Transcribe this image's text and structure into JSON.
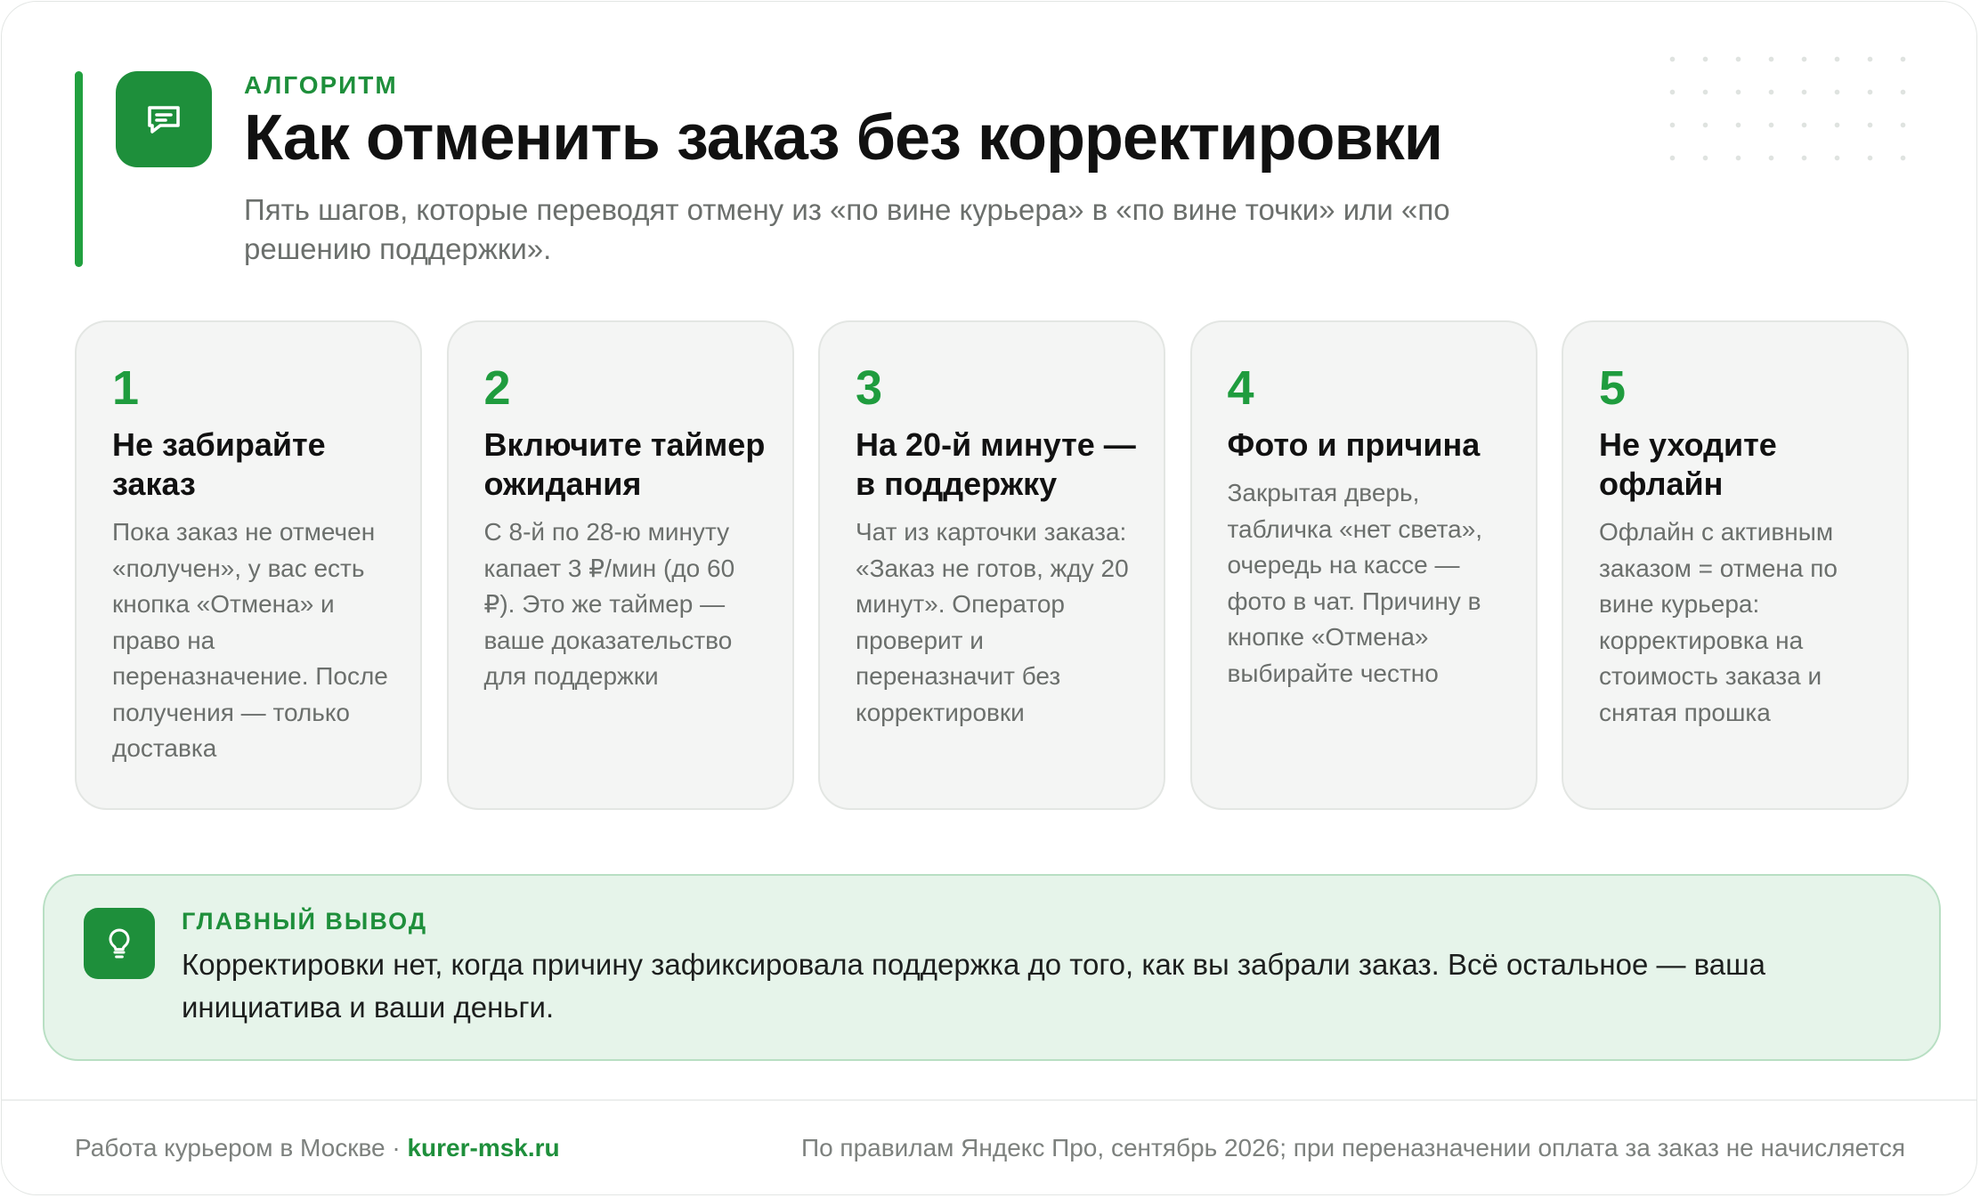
{
  "header": {
    "eyebrow": "АЛГОРИТМ",
    "title": "Как отменить заказ без корректировки",
    "subtitle": "Пять шагов, которые переводят отмену из «по вине курьера» в «по вине точки» или «по решению поддержки».",
    "icon": "chat-icon"
  },
  "steps": [
    {
      "number": "1",
      "title": "Не забирайте заказ",
      "text": "Пока заказ не отмечен «получен», у вас есть кнопка «Отмена» и право на переназначение. После получения — только доставка"
    },
    {
      "number": "2",
      "title": "Включите таймер ожидания",
      "text": "С 8-й по 28-ю минуту капает 3 ₽/мин (до 60 ₽). Это же таймер — ваше доказательство для поддержки"
    },
    {
      "number": "3",
      "title": "На 20-й минуте — в поддержку",
      "text": "Чат из карточки заказа: «Заказ не готов, жду 20 минут». Оператор проверит и переназначит без корректировки"
    },
    {
      "number": "4",
      "title": "Фото и причина",
      "text": "Закрытая дверь, табличка «нет света», очередь на кассе — фото в чат. Причину в кнопке «Отмена» выбирайте честно"
    },
    {
      "number": "5",
      "title": "Не уходите офлайн",
      "text": "Офлайн с активным заказом = отмена по вине курьера: корректировка на стоимость заказа и снятая прошка"
    }
  ],
  "conclusion": {
    "label": "ГЛАВНЫЙ ВЫВОД",
    "text": "Корректировки нет, когда причину зафиксировала поддержка до того, как вы забрали заказ. Всё остальное — ваша инициатива и ваши деньги.",
    "icon": "lightbulb-icon"
  },
  "footer": {
    "left_text": "Работа курьером в Москве · ",
    "site": "kurer-msk.ru",
    "right_text": "По правилам Яндекс Про, сентябрь 2026; при переназначении оплата за заказ не начисляется"
  },
  "colors": {
    "accent": "#1e8f3b",
    "step_number": "#1f9c3e",
    "card_bg": "#f4f5f4",
    "conclusion_bg": "#e6f4ea",
    "muted_text": "#6b6f6c"
  }
}
